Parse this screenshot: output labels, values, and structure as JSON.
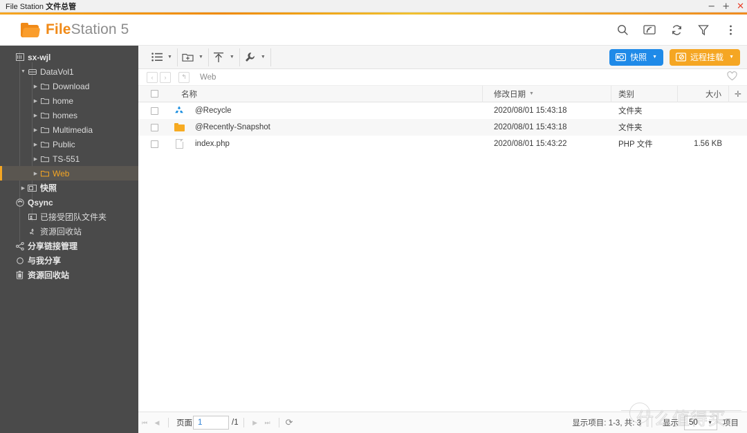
{
  "window": {
    "title_en": "File Station",
    "title_cn": "文件总管",
    "minimize": "−",
    "maximize": "+",
    "close": "✕"
  },
  "app": {
    "logo_bold": "File",
    "logo_rest": "Station 5",
    "accent_color": "#f08a17",
    "header_icons": [
      {
        "name": "search-icon",
        "glyph": "search"
      },
      {
        "name": "cast-icon",
        "glyph": "cast"
      },
      {
        "name": "refresh-icon",
        "glyph": "refresh"
      },
      {
        "name": "filter-icon",
        "glyph": "filter"
      },
      {
        "name": "more-options-icon",
        "glyph": "dots"
      }
    ]
  },
  "sidebar": {
    "items": [
      {
        "label": "sx-wjl",
        "icon": "nas-icon",
        "indent": 0,
        "arrow": "none",
        "bold": true,
        "selected": false
      },
      {
        "label": "DataVol1",
        "icon": "volume-icon",
        "indent": 1,
        "arrow": "expanded",
        "bold": false,
        "selected": false
      },
      {
        "label": "Download",
        "icon": "folder-icon",
        "indent": 2,
        "arrow": "collapsed",
        "bold": false,
        "selected": false
      },
      {
        "label": "home",
        "icon": "folder-icon",
        "indent": 2,
        "arrow": "collapsed",
        "bold": false,
        "selected": false
      },
      {
        "label": "homes",
        "icon": "folder-icon",
        "indent": 2,
        "arrow": "collapsed",
        "bold": false,
        "selected": false
      },
      {
        "label": "Multimedia",
        "icon": "folder-icon",
        "indent": 2,
        "arrow": "collapsed",
        "bold": false,
        "selected": false
      },
      {
        "label": "Public",
        "icon": "folder-icon",
        "indent": 2,
        "arrow": "collapsed",
        "bold": false,
        "selected": false
      },
      {
        "label": "TS-551",
        "icon": "folder-icon",
        "indent": 2,
        "arrow": "collapsed",
        "bold": false,
        "selected": false
      },
      {
        "label": "Web",
        "icon": "folder-icon",
        "indent": 2,
        "arrow": "collapsed",
        "bold": false,
        "selected": true
      },
      {
        "label": "快照",
        "icon": "snapshot-icon",
        "indent": 1,
        "arrow": "collapsed",
        "bold": true,
        "selected": false
      },
      {
        "label": "Qsync",
        "icon": "qsync-icon",
        "indent": 0,
        "arrow": "none",
        "bold": true,
        "selected": false
      },
      {
        "label": "已接受团队文件夹",
        "icon": "team-folder-icon",
        "indent": 1,
        "arrow": "none",
        "bold": false,
        "selected": false
      },
      {
        "label": "资源回收站",
        "icon": "recycle-icon",
        "indent": 1,
        "arrow": "none",
        "bold": false,
        "selected": false
      },
      {
        "label": "分享链接管理",
        "icon": "share-icon",
        "indent": 0,
        "arrow": "none",
        "bold": true,
        "selected": false
      },
      {
        "label": "与我分享",
        "icon": "shared-icon",
        "indent": 0,
        "arrow": "none",
        "bold": true,
        "selected": false
      },
      {
        "label": "资源回收站",
        "icon": "trash-icon",
        "indent": 0,
        "arrow": "none",
        "bold": true,
        "selected": false
      }
    ]
  },
  "toolbar": {
    "groups": [
      {
        "name": "view-mode-button",
        "icon": "list-view-icon"
      },
      {
        "name": "new-folder-button",
        "icon": "folder-plus-icon"
      },
      {
        "name": "upload-button",
        "icon": "upload-arrow-icon"
      },
      {
        "name": "tools-button",
        "icon": "wrench-icon"
      }
    ],
    "snapshot_button": "快照",
    "remote_mount_button": "远程挂载"
  },
  "breadcrumb": {
    "back": "‹",
    "forward": "›",
    "up": "↰",
    "path": "Web"
  },
  "table": {
    "columns": [
      "名称",
      "修改日期",
      "类别",
      "大小"
    ],
    "sorted_by": "修改日期",
    "sort_dir": "desc",
    "add_column": "✛",
    "rows": [
      {
        "name": "@Recycle",
        "icon": "recycle-icon",
        "date": "2020/08/01 15:43:18",
        "type": "文件夹",
        "size": ""
      },
      {
        "name": "@Recently-Snapshot",
        "icon": "folder-icon",
        "date": "2020/08/01 15:43:18",
        "type": "文件夹",
        "size": ""
      },
      {
        "name": "index.php",
        "icon": "file-icon",
        "date": "2020/08/01 15:43:22",
        "type": "PHP 文件",
        "size": "1.56 KB"
      }
    ]
  },
  "footer": {
    "first": "⏮",
    "prev": "◀",
    "page_label": "页面",
    "page_value": "1",
    "page_total": "/1",
    "next": "▶",
    "last": "⏭",
    "refresh": "⟳",
    "items_status": "显示项目: 1-3, 共: 3",
    "show_label": "显示",
    "page_size": "50",
    "items_label": "项目"
  },
  "watermark": {
    "text": "什么值得买",
    "mark": "值"
  }
}
